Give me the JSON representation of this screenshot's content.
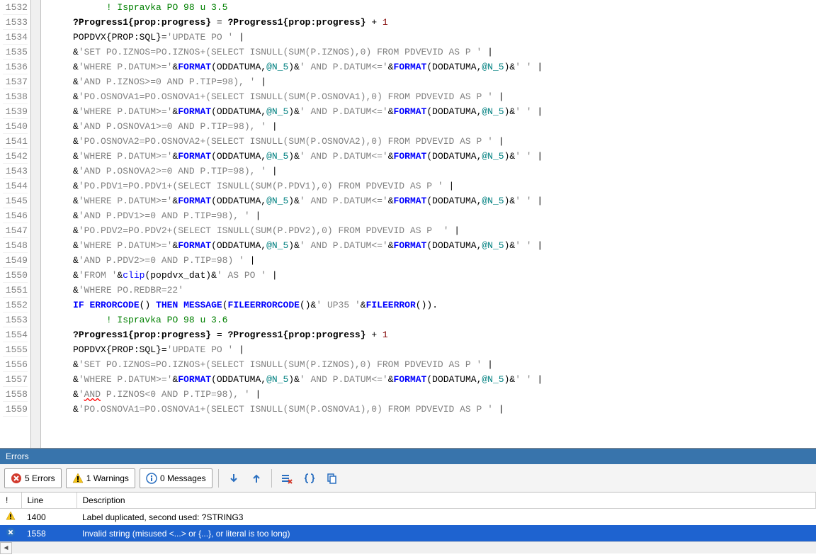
{
  "gutter_start": 1532,
  "gutter_end": 1559,
  "code_lines": [
    {
      "segs": [
        {
          "t": "           ",
          "c": "c-plain"
        },
        {
          "t": "! Ispravka PO 98 u 3.5",
          "c": "c-comment"
        }
      ]
    },
    {
      "segs": [
        {
          "t": "     ",
          "c": "c-plain"
        },
        {
          "t": "?Progress1{prop:progress}",
          "c": "c-prop"
        },
        {
          "t": " = ",
          "c": "c-plain"
        },
        {
          "t": "?Progress1{prop:progress}",
          "c": "c-prop"
        },
        {
          "t": " + ",
          "c": "c-plain"
        },
        {
          "t": "1",
          "c": "c-number"
        }
      ]
    },
    {
      "segs": [
        {
          "t": "     POPDVX{",
          "c": "c-plain"
        },
        {
          "t": "PROP:SQL",
          "c": "c-black"
        },
        {
          "t": "}=",
          "c": "c-plain"
        },
        {
          "t": "'UPDATE PO '",
          "c": "c-string"
        },
        {
          "t": " |",
          "c": "c-plain"
        }
      ]
    },
    {
      "segs": [
        {
          "t": "     &",
          "c": "c-plain"
        },
        {
          "t": "'SET PO.IZNOS=PO.IZNOS+(SELECT ISNULL(SUM(P.IZNOS),0) FROM PDVEVID AS P '",
          "c": "c-string"
        },
        {
          "t": " |",
          "c": "c-plain"
        }
      ]
    },
    {
      "segs": [
        {
          "t": "     &",
          "c": "c-plain"
        },
        {
          "t": "'WHERE P.DATUM>='",
          "c": "c-string"
        },
        {
          "t": "&",
          "c": "c-plain"
        },
        {
          "t": "FORMAT",
          "c": "c-keyword"
        },
        {
          "t": "(ODDATUMA,",
          "c": "c-plain"
        },
        {
          "t": "@N_5",
          "c": "c-param"
        },
        {
          "t": ")&",
          "c": "c-plain"
        },
        {
          "t": "' AND P.DATUM<='",
          "c": "c-string"
        },
        {
          "t": "&",
          "c": "c-plain"
        },
        {
          "t": "FORMAT",
          "c": "c-keyword"
        },
        {
          "t": "(DODATUMA,",
          "c": "c-plain"
        },
        {
          "t": "@N_5",
          "c": "c-param"
        },
        {
          "t": ")&",
          "c": "c-plain"
        },
        {
          "t": "' '",
          "c": "c-string"
        },
        {
          "t": " |",
          "c": "c-plain"
        }
      ]
    },
    {
      "segs": [
        {
          "t": "     &",
          "c": "c-plain"
        },
        {
          "t": "'AND P.IZNOS>=0 AND P.TIP=98), '",
          "c": "c-string"
        },
        {
          "t": " |",
          "c": "c-plain"
        }
      ]
    },
    {
      "segs": [
        {
          "t": "     &",
          "c": "c-plain"
        },
        {
          "t": "'PO.OSNOVA1=PO.OSNOVA1+(SELECT ISNULL(SUM(P.OSNOVA1),0) FROM PDVEVID AS P '",
          "c": "c-string"
        },
        {
          "t": " |",
          "c": "c-plain"
        }
      ]
    },
    {
      "segs": [
        {
          "t": "     &",
          "c": "c-plain"
        },
        {
          "t": "'WHERE P.DATUM>='",
          "c": "c-string"
        },
        {
          "t": "&",
          "c": "c-plain"
        },
        {
          "t": "FORMAT",
          "c": "c-keyword"
        },
        {
          "t": "(ODDATUMA,",
          "c": "c-plain"
        },
        {
          "t": "@N_5",
          "c": "c-param"
        },
        {
          "t": ")&",
          "c": "c-plain"
        },
        {
          "t": "' AND P.DATUM<='",
          "c": "c-string"
        },
        {
          "t": "&",
          "c": "c-plain"
        },
        {
          "t": "FORMAT",
          "c": "c-keyword"
        },
        {
          "t": "(DODATUMA,",
          "c": "c-plain"
        },
        {
          "t": "@N_5",
          "c": "c-param"
        },
        {
          "t": ")&",
          "c": "c-plain"
        },
        {
          "t": "' '",
          "c": "c-string"
        },
        {
          "t": " |",
          "c": "c-plain"
        }
      ]
    },
    {
      "segs": [
        {
          "t": "     &",
          "c": "c-plain"
        },
        {
          "t": "'AND P.OSNOVA1>=0 AND P.TIP=98), '",
          "c": "c-string"
        },
        {
          "t": " |",
          "c": "c-plain"
        }
      ]
    },
    {
      "segs": [
        {
          "t": "     &",
          "c": "c-plain"
        },
        {
          "t": "'PO.OSNOVA2=PO.OSNOVA2+(SELECT ISNULL(SUM(P.OSNOVA2),0) FROM PDVEVID AS P '",
          "c": "c-string"
        },
        {
          "t": " |",
          "c": "c-plain"
        }
      ]
    },
    {
      "segs": [
        {
          "t": "     &",
          "c": "c-plain"
        },
        {
          "t": "'WHERE P.DATUM>='",
          "c": "c-string"
        },
        {
          "t": "&",
          "c": "c-plain"
        },
        {
          "t": "FORMAT",
          "c": "c-keyword"
        },
        {
          "t": "(ODDATUMA,",
          "c": "c-plain"
        },
        {
          "t": "@N_5",
          "c": "c-param"
        },
        {
          "t": ")&",
          "c": "c-plain"
        },
        {
          "t": "' AND P.DATUM<='",
          "c": "c-string"
        },
        {
          "t": "&",
          "c": "c-plain"
        },
        {
          "t": "FORMAT",
          "c": "c-keyword"
        },
        {
          "t": "(DODATUMA,",
          "c": "c-plain"
        },
        {
          "t": "@N_5",
          "c": "c-param"
        },
        {
          "t": ")&",
          "c": "c-plain"
        },
        {
          "t": "' '",
          "c": "c-string"
        },
        {
          "t": " |",
          "c": "c-plain"
        }
      ]
    },
    {
      "segs": [
        {
          "t": "     &",
          "c": "c-plain"
        },
        {
          "t": "'AND P.OSNOVA2>=0 AND P.TIP=98), '",
          "c": "c-string"
        },
        {
          "t": " |",
          "c": "c-plain"
        }
      ]
    },
    {
      "segs": [
        {
          "t": "     &",
          "c": "c-plain"
        },
        {
          "t": "'PO.PDV1=PO.PDV1+(SELECT ISNULL(SUM(P.PDV1),0) FROM PDVEVID AS P '",
          "c": "c-string"
        },
        {
          "t": " |",
          "c": "c-plain"
        }
      ]
    },
    {
      "segs": [
        {
          "t": "     &",
          "c": "c-plain"
        },
        {
          "t": "'WHERE P.DATUM>='",
          "c": "c-string"
        },
        {
          "t": "&",
          "c": "c-plain"
        },
        {
          "t": "FORMAT",
          "c": "c-keyword"
        },
        {
          "t": "(ODDATUMA,",
          "c": "c-plain"
        },
        {
          "t": "@N_5",
          "c": "c-param"
        },
        {
          "t": ")&",
          "c": "c-plain"
        },
        {
          "t": "' AND P.DATUM<='",
          "c": "c-string"
        },
        {
          "t": "&",
          "c": "c-plain"
        },
        {
          "t": "FORMAT",
          "c": "c-keyword"
        },
        {
          "t": "(DODATUMA,",
          "c": "c-plain"
        },
        {
          "t": "@N_5",
          "c": "c-param"
        },
        {
          "t": ")&",
          "c": "c-plain"
        },
        {
          "t": "' '",
          "c": "c-string"
        },
        {
          "t": " |",
          "c": "c-plain"
        }
      ]
    },
    {
      "segs": [
        {
          "t": "     &",
          "c": "c-plain"
        },
        {
          "t": "'AND P.PDV1>=0 AND P.TIP=98), '",
          "c": "c-string"
        },
        {
          "t": " |",
          "c": "c-plain"
        }
      ]
    },
    {
      "segs": [
        {
          "t": "     &",
          "c": "c-plain"
        },
        {
          "t": "'PO.PDV2=PO.PDV2+(SELECT ISNULL(SUM(P.PDV2),0) FROM PDVEVID AS P  '",
          "c": "c-string"
        },
        {
          "t": " |",
          "c": "c-plain"
        }
      ]
    },
    {
      "segs": [
        {
          "t": "     &",
          "c": "c-plain"
        },
        {
          "t": "'WHERE P.DATUM>='",
          "c": "c-string"
        },
        {
          "t": "&",
          "c": "c-plain"
        },
        {
          "t": "FORMAT",
          "c": "c-keyword"
        },
        {
          "t": "(ODDATUMA,",
          "c": "c-plain"
        },
        {
          "t": "@N_5",
          "c": "c-param"
        },
        {
          "t": ")&",
          "c": "c-plain"
        },
        {
          "t": "' AND P.DATUM<='",
          "c": "c-string"
        },
        {
          "t": "&",
          "c": "c-plain"
        },
        {
          "t": "FORMAT",
          "c": "c-keyword"
        },
        {
          "t": "(DODATUMA,",
          "c": "c-plain"
        },
        {
          "t": "@N_5",
          "c": "c-param"
        },
        {
          "t": ")&",
          "c": "c-plain"
        },
        {
          "t": "' '",
          "c": "c-string"
        },
        {
          "t": " |",
          "c": "c-plain"
        }
      ]
    },
    {
      "segs": [
        {
          "t": "     &",
          "c": "c-plain"
        },
        {
          "t": "'AND P.PDV2>=0 AND P.TIP=98) '",
          "c": "c-string"
        },
        {
          "t": " |",
          "c": "c-plain"
        }
      ]
    },
    {
      "segs": [
        {
          "t": "     &",
          "c": "c-plain"
        },
        {
          "t": "'FROM '",
          "c": "c-string"
        },
        {
          "t": "&",
          "c": "c-plain"
        },
        {
          "t": "clip",
          "c": "c-keyword2"
        },
        {
          "t": "(popdvx_dat)&",
          "c": "c-plain"
        },
        {
          "t": "' AS PO '",
          "c": "c-string"
        },
        {
          "t": " |",
          "c": "c-plain"
        }
      ]
    },
    {
      "segs": [
        {
          "t": "     &",
          "c": "c-plain"
        },
        {
          "t": "'WHERE PO.REDBR=22'",
          "c": "c-string"
        }
      ]
    },
    {
      "segs": [
        {
          "t": "     ",
          "c": "c-plain"
        },
        {
          "t": "IF",
          "c": "c-keyword"
        },
        {
          "t": " ",
          "c": "c-plain"
        },
        {
          "t": "ERRORCODE",
          "c": "c-keyword"
        },
        {
          "t": "() ",
          "c": "c-plain"
        },
        {
          "t": "THEN",
          "c": "c-keyword"
        },
        {
          "t": " ",
          "c": "c-plain"
        },
        {
          "t": "MESSAGE",
          "c": "c-keyword"
        },
        {
          "t": "(",
          "c": "c-plain"
        },
        {
          "t": "FILEERRORCODE",
          "c": "c-keyword"
        },
        {
          "t": "()&",
          "c": "c-plain"
        },
        {
          "t": "' UP35 '",
          "c": "c-string"
        },
        {
          "t": "&",
          "c": "c-plain"
        },
        {
          "t": "FILEERROR",
          "c": "c-keyword"
        },
        {
          "t": "()).",
          "c": "c-plain"
        }
      ]
    },
    {
      "segs": [
        {
          "t": "           ",
          "c": "c-plain"
        },
        {
          "t": "! Ispravka PO 98 u 3.6",
          "c": "c-comment"
        }
      ]
    },
    {
      "segs": [
        {
          "t": "     ",
          "c": "c-plain"
        },
        {
          "t": "?Progress1{prop:progress}",
          "c": "c-prop"
        },
        {
          "t": " = ",
          "c": "c-plain"
        },
        {
          "t": "?Progress1{prop:progress}",
          "c": "c-prop"
        },
        {
          "t": " + ",
          "c": "c-plain"
        },
        {
          "t": "1",
          "c": "c-number"
        }
      ]
    },
    {
      "segs": [
        {
          "t": "     POPDVX{",
          "c": "c-plain"
        },
        {
          "t": "PROP:SQL",
          "c": "c-black"
        },
        {
          "t": "}=",
          "c": "c-plain"
        },
        {
          "t": "'UPDATE PO '",
          "c": "c-string"
        },
        {
          "t": " |",
          "c": "c-plain"
        }
      ]
    },
    {
      "segs": [
        {
          "t": "     &",
          "c": "c-plain"
        },
        {
          "t": "'SET PO.IZNOS=PO.IZNOS+(SELECT ISNULL(SUM(P.IZNOS),0) FROM PDVEVID AS P '",
          "c": "c-string"
        },
        {
          "t": " |",
          "c": "c-plain"
        }
      ]
    },
    {
      "segs": [
        {
          "t": "     &",
          "c": "c-plain"
        },
        {
          "t": "'WHERE P.DATUM>='",
          "c": "c-string"
        },
        {
          "t": "&",
          "c": "c-plain"
        },
        {
          "t": "FORMAT",
          "c": "c-keyword"
        },
        {
          "t": "(ODDATUMA,",
          "c": "c-plain"
        },
        {
          "t": "@N_5",
          "c": "c-param"
        },
        {
          "t": ")&",
          "c": "c-plain"
        },
        {
          "t": "' AND P.DATUM<='",
          "c": "c-string"
        },
        {
          "t": "&",
          "c": "c-plain"
        },
        {
          "t": "FORMAT",
          "c": "c-keyword"
        },
        {
          "t": "(DODATUMA,",
          "c": "c-plain"
        },
        {
          "t": "@N_5",
          "c": "c-param"
        },
        {
          "t": ")&",
          "c": "c-plain"
        },
        {
          "t": "' '",
          "c": "c-string"
        },
        {
          "t": " |",
          "c": "c-plain"
        }
      ]
    },
    {
      "segs": [
        {
          "t": "     &",
          "c": "c-plain"
        },
        {
          "t": "'",
          "c": "c-string"
        },
        {
          "t": "AND",
          "c": "c-string underline-error"
        },
        {
          "t": " P.IZNOS<0 AND P.TIP=98), '",
          "c": "c-string"
        },
        {
          "t": " |",
          "c": "c-plain"
        }
      ]
    },
    {
      "segs": [
        {
          "t": "     &",
          "c": "c-plain"
        },
        {
          "t": "'PO.OSNOVA1=PO.OSNOVA1+(SELECT ISNULL(SUM(P.OSNOVA1),0) FROM PDVEVID AS P '",
          "c": "c-string"
        },
        {
          "t": " |",
          "c": "c-plain"
        }
      ]
    }
  ],
  "errors_panel": {
    "title": "Errors",
    "pills": {
      "errors": "5 Errors",
      "warnings": "1 Warnings",
      "messages": "0 Messages"
    },
    "columns": {
      "icon": "!",
      "line": "Line",
      "description": "Description"
    },
    "rows": [
      {
        "type": "warning",
        "line": "1400",
        "desc": "Label duplicated, second used: ?STRING3",
        "selected": false
      },
      {
        "type": "error",
        "line": "1558",
        "desc": "Invalid string (misused <...> or {...}, or literal is too long)",
        "selected": true
      }
    ]
  }
}
